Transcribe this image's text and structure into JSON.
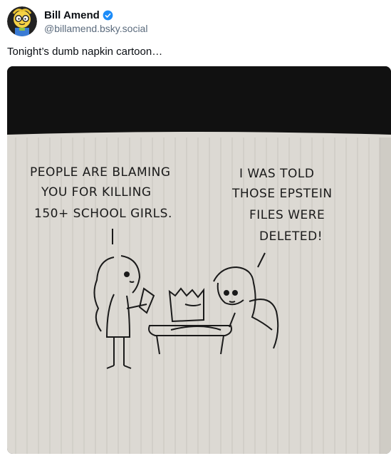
{
  "post": {
    "author": {
      "display_name": "Bill Amend",
      "handle": "@billamend.bsky.social",
      "verified_icon": "verified-badge-icon",
      "verified_color": "#1d8cf8"
    },
    "text": "Tonight’s dumb napkin cartoon…",
    "image": {
      "left_speech": [
        "PEOPLE ARE BLAMING",
        "YOU FOR KILLING",
        "150+ SCHOOL GIRLS."
      ],
      "right_speech": [
        "I WAS TOLD",
        "THOSE EPSTEIN",
        "FILES WERE",
        "DELETED!"
      ]
    }
  }
}
